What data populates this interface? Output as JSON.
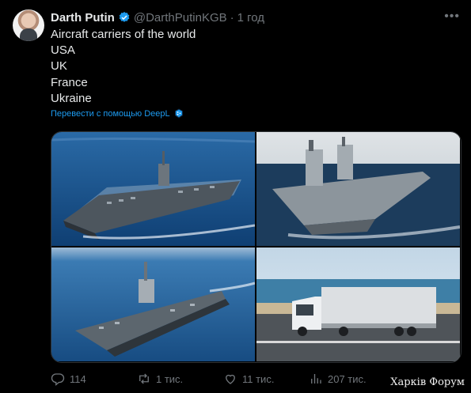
{
  "author": {
    "name": "Darth Putin",
    "handle": "@DarthPutinKGB",
    "separator": "·",
    "time": "1 год",
    "avatar_icon": "user-avatar",
    "verified_icon": "verified-badge-icon"
  },
  "more_icon": "more-dots-icon",
  "tweet_lines": [
    "Aircraft carriers of the world",
    "USA",
    "UK",
    "France",
    "Ukraine"
  ],
  "translate": {
    "label": "Перевести с помощью DeepL",
    "icon": "deepl-icon"
  },
  "media": [
    {
      "name": "usa-carrier-image",
      "icon": "photo"
    },
    {
      "name": "uk-carrier-image",
      "icon": "photo"
    },
    {
      "name": "france-carrier-image",
      "icon": "photo"
    },
    {
      "name": "ukraine-truck-image",
      "icon": "photo"
    }
  ],
  "actions": {
    "reply": {
      "count": "114",
      "icon": "reply-icon"
    },
    "retweet": {
      "count": "1 тис.",
      "icon": "retweet-icon"
    },
    "like": {
      "count": "11 тис.",
      "icon": "heart-icon"
    },
    "views": {
      "count": "207 тис.",
      "icon": "views-icon"
    }
  },
  "watermark": "Харків Форум",
  "colors": {
    "background": "#000000",
    "text": "#e7e9ea",
    "muted": "#71767b",
    "accent": "#1d9bf0"
  }
}
